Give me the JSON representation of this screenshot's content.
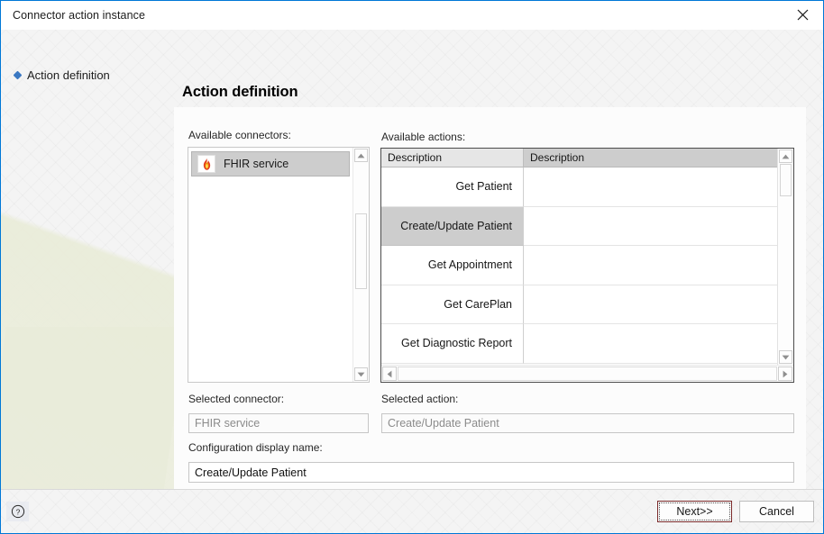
{
  "window": {
    "title": "Connector action instance",
    "close_icon": "close-icon",
    "border_color": "#0078d7"
  },
  "sidebar": {
    "items": [
      {
        "label": "Action definition",
        "bullet_color": "#3b78c2"
      }
    ]
  },
  "page": {
    "title": "Action definition"
  },
  "connectors": {
    "label": "Available connectors:",
    "items": [
      {
        "name": "FHIR service",
        "icon": "flame-icon",
        "selected": true
      }
    ],
    "scroll_up_icon": "triangle-up-icon",
    "scroll_down_icon": "triangle-down-icon"
  },
  "actions": {
    "label": "Available actions:",
    "columns": [
      "Description",
      "Description"
    ],
    "rows": [
      {
        "description": "Get Patient",
        "detail": "",
        "selected": false
      },
      {
        "description": "Create/Update Patient",
        "detail": "",
        "selected": true
      },
      {
        "description": "Get Appointment",
        "detail": "",
        "selected": false
      },
      {
        "description": "Get CarePlan",
        "detail": "",
        "selected": false
      },
      {
        "description": "Get Diagnostic Report",
        "detail": "",
        "selected": false
      }
    ],
    "scroll_up_icon": "triangle-up-icon",
    "scroll_down_icon": "triangle-down-icon",
    "scroll_left_icon": "triangle-left-icon",
    "scroll_right_icon": "triangle-right-icon"
  },
  "fields": {
    "selected_connector": {
      "label": "Selected connector:",
      "value": "FHIR service"
    },
    "selected_action": {
      "label": "Selected action:",
      "value": "Create/Update Patient"
    },
    "configuration_display_name": {
      "label": "Configuration display name:",
      "value": "Create/Update Patient"
    }
  },
  "footer": {
    "help_icon": "help-circle-icon",
    "next_label": "Next>>",
    "cancel_label": "Cancel"
  }
}
